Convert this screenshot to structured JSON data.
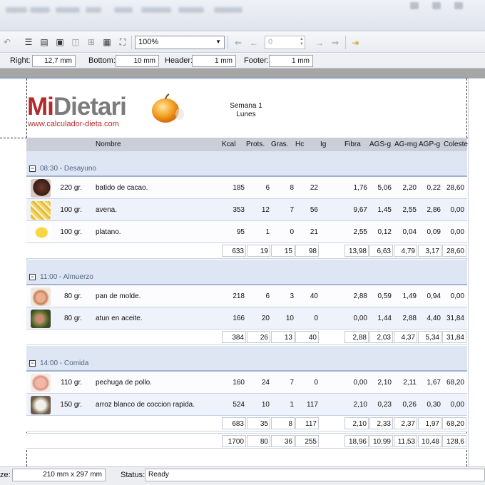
{
  "toolbar": {
    "zoom_value": "100%",
    "page_value": "0"
  },
  "margins": {
    "right_label": "Right:",
    "right_value": "12,7 mm",
    "bottom_label": "Bottom:",
    "bottom_value": "10 mm",
    "header_label": "Header:",
    "header_value": "1 mm",
    "footer_label": "Footer:",
    "footer_value": "1 mm"
  },
  "report": {
    "logo_text_red": "MiDietari",
    "logo_url": "www.calculador-dieta.com",
    "week_line1": "Semana 1",
    "week_line2": "Lunes",
    "columns": {
      "nombre": "Nombre",
      "kcal": "Kcal",
      "prots": "Prots.",
      "gras": "Gras.",
      "hc": "Hc",
      "ig": "Ig",
      "fibra": "Fibra",
      "ags": "AGS-g",
      "agm": "AG-mg",
      "agp": "AGP-g",
      "coles": "Coleste"
    },
    "groups": [
      {
        "title": "08:30 - Desayuno",
        "items": [
          {
            "qty": "220 gr.",
            "name": "batido de cacao.",
            "kcal": "185",
            "prots": "6",
            "gras": "8",
            "hc": "22",
            "fibra": "1,76",
            "ags": "5,06",
            "agm": "2,20",
            "agp": "0,22",
            "coles": "28,60"
          },
          {
            "qty": "100 gr.",
            "name": "avena.",
            "kcal": "353",
            "prots": "12",
            "gras": "7",
            "hc": "56",
            "fibra": "9,67",
            "ags": "1,45",
            "agm": "2,55",
            "agp": "2,86",
            "coles": "0,00"
          },
          {
            "qty": "100 gr.",
            "name": "platano.",
            "kcal": "95",
            "prots": "1",
            "gras": "0",
            "hc": "21",
            "fibra": "2,55",
            "ags": "0,12",
            "agm": "0,04",
            "agp": "0,09",
            "coles": "0,00"
          }
        ],
        "total": {
          "kcal": "633",
          "prots": "19",
          "gras": "15",
          "hc": "98",
          "fibra": "13,98",
          "ags": "6,63",
          "agm": "4,79",
          "agp": "3,17",
          "coles": "28,60"
        }
      },
      {
        "title": "11:00 - Almuerzo",
        "items": [
          {
            "qty": "80 gr.",
            "name": "pan de molde.",
            "kcal": "218",
            "prots": "6",
            "gras": "3",
            "hc": "40",
            "fibra": "2,88",
            "ags": "0,59",
            "agm": "1,49",
            "agp": "0,94",
            "coles": "0,00"
          },
          {
            "qty": "80 gr.",
            "name": "atun en aceite.",
            "kcal": "166",
            "prots": "20",
            "gras": "10",
            "hc": "0",
            "fibra": "0,00",
            "ags": "1,44",
            "agm": "2,88",
            "agp": "4,40",
            "coles": "31,84"
          }
        ],
        "total": {
          "kcal": "384",
          "prots": "26",
          "gras": "13",
          "hc": "40",
          "fibra": "2,88",
          "ags": "2,03",
          "agm": "4,37",
          "agp": "5,34",
          "coles": "31,84"
        }
      },
      {
        "title": "14:00 - Comida",
        "items": [
          {
            "qty": "110 gr.",
            "name": "pechuga de pollo.",
            "kcal": "160",
            "prots": "24",
            "gras": "7",
            "hc": "0",
            "fibra": "0,00",
            "ags": "2,10",
            "agm": "2,11",
            "agp": "1,67",
            "coles": "68,20"
          },
          {
            "qty": "150 gr.",
            "name": "arroz blanco de coccion rapida.",
            "kcal": "524",
            "prots": "10",
            "gras": "1",
            "hc": "117",
            "fibra": "2,10",
            "ags": "0,23",
            "agm": "0,26",
            "agp": "0,30",
            "coles": "0,00"
          }
        ],
        "total": {
          "kcal": "683",
          "prots": "35",
          "gras": "8",
          "hc": "117",
          "fibra": "2,10",
          "ags": "2,33",
          "agm": "2,37",
          "agp": "1,97",
          "coles": "68,20"
        }
      }
    ],
    "grand_total": {
      "kcal": "1700",
      "prots": "80",
      "gras": "36",
      "hc": "255",
      "fibra": "18,96",
      "ags": "10,99",
      "agm": "11,53",
      "agp": "10,48",
      "coles": "128,6"
    }
  },
  "status": {
    "size_label": "ze:",
    "size_value": "210 mm x 297 mm",
    "status_label": "Status:",
    "status_value": "Ready"
  },
  "colors": {
    "brand_red": "#b5292b",
    "header_grey": "#c9ced7",
    "group_bg": "#dfe6f3",
    "group_title": "#4e6688"
  }
}
